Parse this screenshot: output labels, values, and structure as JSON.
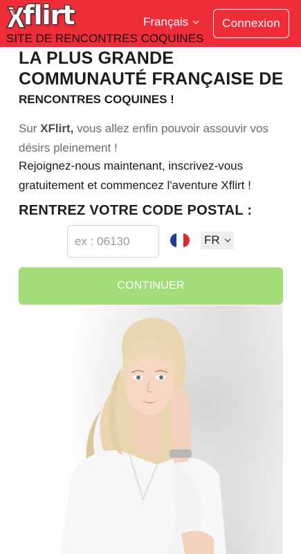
{
  "header": {
    "logo_text": "flirt",
    "language": "Français",
    "login_label": "Connexion",
    "tagline": "SITE DE RENCONTRES COQUINES"
  },
  "hero": {
    "headline": "LA PLUS GRANDE COMMUNAUTÉ FRANÇAISE DE",
    "subheadline": "RENCONTRES COQUINES !",
    "intro_prefix": "Sur ",
    "intro_brand": "XFlirt,",
    "intro_suffix": " vous allez enfin pouvoir assouvir vos désirs pleinement !",
    "intro_2": "Rejoignez-nous maintenant, inscrivez-vous gratuitement et commencez l'aventure Xflirt !"
  },
  "form": {
    "zip_title": "RENTREZ VOTRE CODE POSTAL :",
    "zip_placeholder": "ex : 06130",
    "zip_value": "",
    "country": "FR",
    "continue_label": "CONTINUER"
  },
  "colors": {
    "header_bg": "#ef2d38",
    "continue_bg": "#a3dd7a"
  },
  "icons": {
    "language_chevron": "chevron-down-icon",
    "country_chevron": "chevron-down-icon",
    "flag": "france-flag-icon"
  }
}
